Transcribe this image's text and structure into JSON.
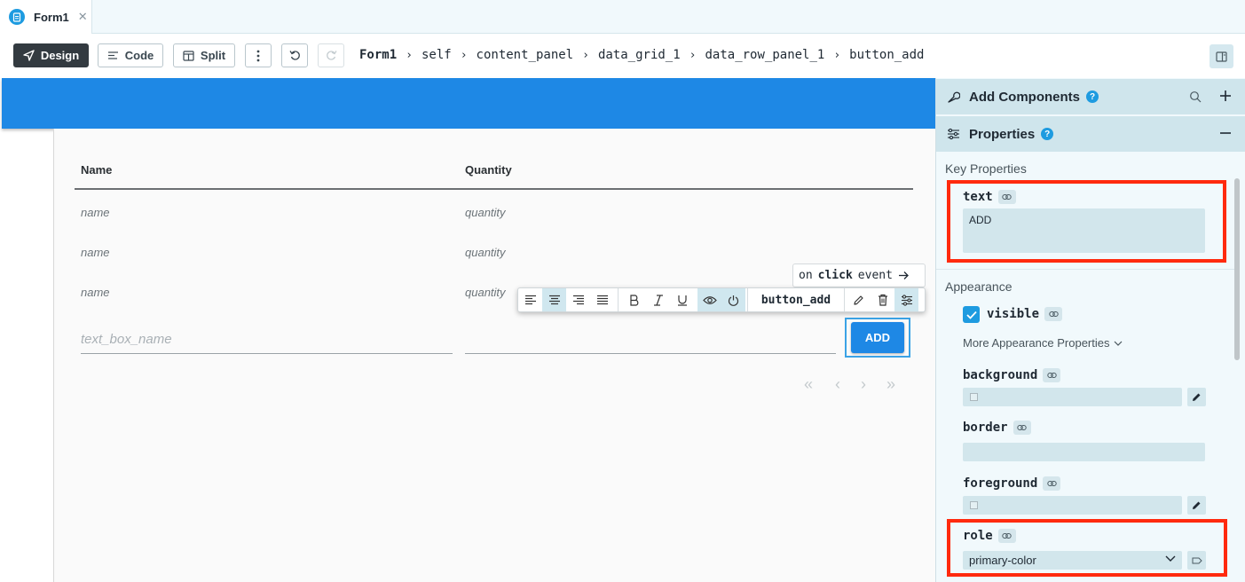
{
  "tab": {
    "label": "Form1"
  },
  "toolbar": {
    "design_label": "Design",
    "code_label": "Code",
    "split_label": "Split",
    "breadcrumb": [
      "Form1",
      "self",
      "content_panel",
      "data_grid_1",
      "data_row_panel_1",
      "button_add"
    ]
  },
  "grid": {
    "headers": [
      "Name",
      "Quantity"
    ],
    "rows": [
      {
        "name": "name",
        "quantity": "quantity"
      },
      {
        "name": "name",
        "quantity": "quantity"
      },
      {
        "name": "name",
        "quantity": "quantity"
      }
    ],
    "textbox_placeholder": "text_box_name",
    "add_button_label": "ADD"
  },
  "floating": {
    "event_prefix": "on",
    "event_name": "click",
    "event_suffix": "event",
    "component_name": "button_add"
  },
  "panel": {
    "add_components": "Add Components",
    "properties": "Properties",
    "key_properties": "Key Properties",
    "text_label": "text",
    "text_value": "ADD",
    "appearance": "Appearance",
    "visible_label": "visible",
    "visible_checked": true,
    "more_appearance": "More Appearance Properties",
    "background_label": "background",
    "border_label": "border",
    "foreground_label": "foreground",
    "role_label": "role",
    "role_value": "primary-color"
  },
  "colors": {
    "accent": "#1e9be0",
    "header_blue": "#1e88e5",
    "highlight_red": "#ff2a0e",
    "panel_bg": "#f1f9fc"
  }
}
